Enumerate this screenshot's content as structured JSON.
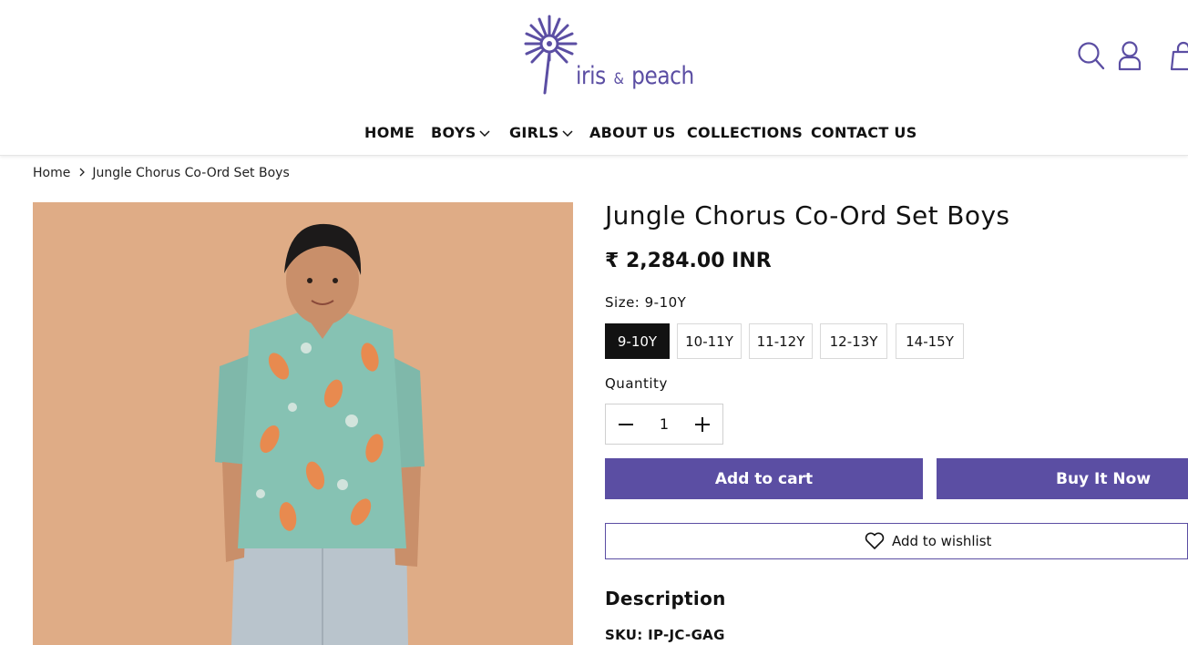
{
  "header": {
    "logo_text_1": "iris",
    "logo_amp": "&",
    "logo_text_2": "peach",
    "icons": [
      "search-icon",
      "account-icon",
      "cart-icon"
    ]
  },
  "nav": {
    "items": [
      {
        "label": "HOME",
        "has_dropdown": false
      },
      {
        "label": "BOYS",
        "has_dropdown": true
      },
      {
        "label": "GIRLS",
        "has_dropdown": true
      },
      {
        "label": "ABOUT US",
        "has_dropdown": false
      },
      {
        "label": "COLLECTIONS",
        "has_dropdown": false
      },
      {
        "label": "CONTACT US",
        "has_dropdown": false
      }
    ]
  },
  "breadcrumb": {
    "home": "Home",
    "current": "Jungle Chorus Co-Ord Set Boys"
  },
  "product": {
    "title": "Jungle Chorus Co-Ord Set Boys",
    "price": "₹ 2,284.00 INR",
    "size_label": "Size:",
    "selected_size": "9-10Y",
    "sizes": [
      "9-10Y",
      "10-11Y",
      "11-12Y",
      "12-13Y",
      "14-15Y"
    ],
    "quantity_label": "Quantity",
    "quantity": "1",
    "add_to_cart": "Add to cart",
    "buy_now": "Buy It Now",
    "wishlist": "Add to wishlist",
    "description_title": "Description",
    "sku_label": "SKU:",
    "sku": "IP-JC-GAG"
  },
  "colors": {
    "brand": "#5b4ea3",
    "image_background": "#dfac86",
    "text": "#121212"
  }
}
